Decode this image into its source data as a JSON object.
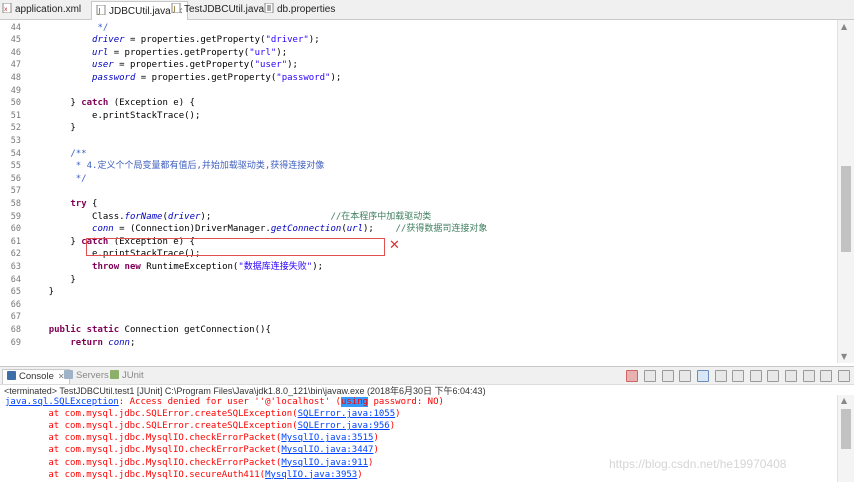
{
  "tabs": [
    {
      "label": "application.xml",
      "icon": "xml-file-icon",
      "active": false
    },
    {
      "label": "JDBCUtil.java",
      "icon": "java-file-icon",
      "active": true
    },
    {
      "label": "TestJDBCUtil.java",
      "icon": "java-file-icon",
      "active": false
    },
    {
      "label": "db.properties",
      "icon": "properties-file-icon",
      "active": false
    }
  ],
  "editor": {
    "lines": [
      {
        "n": "44",
        "tokens": [
          {
            "c": "cmt",
            "t": "             */"
          }
        ]
      },
      {
        "n": "45",
        "tokens": [
          {
            "c": "plain",
            "t": "            "
          },
          {
            "c": "fld",
            "t": "driver"
          },
          {
            "c": "plain",
            "t": " = properties.getProperty("
          },
          {
            "c": "str",
            "t": "\"driver\""
          },
          {
            "c": "plain",
            "t": ");"
          }
        ]
      },
      {
        "n": "46",
        "tokens": [
          {
            "c": "plain",
            "t": "            "
          },
          {
            "c": "fld",
            "t": "url"
          },
          {
            "c": "plain",
            "t": " = properties.getProperty("
          },
          {
            "c": "str",
            "t": "\"url\""
          },
          {
            "c": "plain",
            "t": ");"
          }
        ]
      },
      {
        "n": "47",
        "tokens": [
          {
            "c": "plain",
            "t": "            "
          },
          {
            "c": "fld",
            "t": "user"
          },
          {
            "c": "plain",
            "t": " = properties.getProperty("
          },
          {
            "c": "str",
            "t": "\"user\""
          },
          {
            "c": "plain",
            "t": ");"
          }
        ]
      },
      {
        "n": "48",
        "tokens": [
          {
            "c": "plain",
            "t": "            "
          },
          {
            "c": "fld",
            "t": "password"
          },
          {
            "c": "plain",
            "t": " = properties.getProperty("
          },
          {
            "c": "str",
            "t": "\"password\""
          },
          {
            "c": "plain",
            "t": ");"
          }
        ]
      },
      {
        "n": "49",
        "tokens": []
      },
      {
        "n": "50",
        "tokens": [
          {
            "c": "plain",
            "t": "        } "
          },
          {
            "c": "kw",
            "t": "catch"
          },
          {
            "c": "plain",
            "t": " (Exception e) {"
          }
        ]
      },
      {
        "n": "51",
        "tokens": [
          {
            "c": "plain",
            "t": "            e.printStackTrace();"
          }
        ]
      },
      {
        "n": "52",
        "tokens": [
          {
            "c": "plain",
            "t": "        }"
          }
        ]
      },
      {
        "n": "53",
        "tokens": []
      },
      {
        "n": "54",
        "tokens": [
          {
            "c": "cmt",
            "t": "        /**"
          }
        ]
      },
      {
        "n": "55",
        "tokens": [
          {
            "c": "cmt",
            "t": "         * 4.定义个个局变量都有值后,并始加载驱动类,获得连接对像"
          }
        ]
      },
      {
        "n": "56",
        "tokens": [
          {
            "c": "cmt",
            "t": "         */"
          }
        ]
      },
      {
        "n": "57",
        "tokens": []
      },
      {
        "n": "58",
        "tokens": [
          {
            "c": "plain",
            "t": "        "
          },
          {
            "c": "kw",
            "t": "try"
          },
          {
            "c": "plain",
            "t": " {"
          }
        ]
      },
      {
        "n": "59",
        "tokens": [
          {
            "c": "plain",
            "t": "            Class."
          },
          {
            "c": "fld",
            "t": "forName"
          },
          {
            "c": "plain",
            "t": "("
          },
          {
            "c": "fld",
            "t": "driver"
          },
          {
            "c": "plain",
            "t": ");                      "
          },
          {
            "c": "lcmt",
            "t": "//在本程序中加载驱动类"
          }
        ]
      },
      {
        "n": "60",
        "tokens": [
          {
            "c": "plain",
            "t": "            "
          },
          {
            "c": "fld",
            "t": "conn"
          },
          {
            "c": "plain",
            "t": " = (Connection)DriverManager."
          },
          {
            "c": "fld",
            "t": "getConnection"
          },
          {
            "c": "plain",
            "t": "("
          },
          {
            "c": "fld",
            "t": "url"
          },
          {
            "c": "plain",
            "t": ");    "
          },
          {
            "c": "lcmt",
            "t": "//获得数据司连接对象"
          }
        ]
      },
      {
        "n": "61",
        "tokens": [
          {
            "c": "plain",
            "t": "        } "
          },
          {
            "c": "kw",
            "t": "catch"
          },
          {
            "c": "plain",
            "t": " (Exception e) {"
          }
        ]
      },
      {
        "n": "62",
        "tokens": [
          {
            "c": "plain",
            "t": "            e.printStackTrace();"
          }
        ]
      },
      {
        "n": "63",
        "tokens": [
          {
            "c": "plain",
            "t": "            "
          },
          {
            "c": "kw",
            "t": "throw new"
          },
          {
            "c": "plain",
            "t": " RuntimeException("
          },
          {
            "c": "str",
            "t": "\"数据库连接失败\""
          },
          {
            "c": "plain",
            "t": ");"
          }
        ]
      },
      {
        "n": "64",
        "tokens": [
          {
            "c": "plain",
            "t": "        }"
          }
        ]
      },
      {
        "n": "65",
        "tokens": [
          {
            "c": "plain",
            "t": "    }"
          }
        ]
      },
      {
        "n": "66",
        "tokens": []
      },
      {
        "n": "67",
        "tokens": []
      },
      {
        "n": "68",
        "tokens": [
          {
            "c": "plain",
            "t": "    "
          },
          {
            "c": "kw",
            "t": "public static"
          },
          {
            "c": "plain",
            "t": " Connection getConnection(){"
          }
        ]
      },
      {
        "n": "69",
        "tokens": [
          {
            "c": "plain",
            "t": "        "
          },
          {
            "c": "kw",
            "t": "return"
          },
          {
            "c": "plain",
            "t": " "
          },
          {
            "c": "fld",
            "t": "conn"
          },
          {
            "c": "plain",
            "t": ";"
          }
        ]
      }
    ],
    "annotation_mark": "✕"
  },
  "console_tabs": [
    {
      "label": "Console",
      "icon": "console-icon",
      "active": true
    },
    {
      "label": "Servers",
      "icon": "servers-icon",
      "active": false
    },
    {
      "label": "JUnit",
      "icon": "junit-icon",
      "active": false
    }
  ],
  "terminated_text": "<terminated> TestJDBCUtil.test1 [JUnit] C:\\Program Files\\Java\\jdk1.8.0_121\\bin\\javaw.exe (2018年6月30日 下午6:04:43)",
  "console_lines": [
    [
      {
        "c": "link",
        "t": "java.sql.SQLException"
      },
      {
        "c": "err",
        "t": ": Access denied for user ''@'localhost' ("
      },
      {
        "c": "sel",
        "t": "using"
      },
      {
        "c": "err",
        "t": " password: NO)"
      }
    ],
    [
      {
        "c": "err",
        "t": "\tat com.mysql.jdbc.SQLError.createSQLException("
      },
      {
        "c": "link",
        "t": "SQLError.java:1055"
      },
      {
        "c": "err",
        "t": ")"
      }
    ],
    [
      {
        "c": "err",
        "t": "\tat com.mysql.jdbc.SQLError.createSQLException("
      },
      {
        "c": "link",
        "t": "SQLError.java:956"
      },
      {
        "c": "err",
        "t": ")"
      }
    ],
    [
      {
        "c": "err",
        "t": "\tat com.mysql.jdbc.MysqlIO.checkErrorPacket("
      },
      {
        "c": "link",
        "t": "MysqlIO.java:3515"
      },
      {
        "c": "err",
        "t": ")"
      }
    ],
    [
      {
        "c": "err",
        "t": "\tat com.mysql.jdbc.MysqlIO.checkErrorPacket("
      },
      {
        "c": "link",
        "t": "MysqlIO.java:3447"
      },
      {
        "c": "err",
        "t": ")"
      }
    ],
    [
      {
        "c": "err",
        "t": "\tat com.mysql.jdbc.MysqlIO.checkErrorPacket("
      },
      {
        "c": "link",
        "t": "MysqlIO.java:911"
      },
      {
        "c": "err",
        "t": ")"
      }
    ],
    [
      {
        "c": "err",
        "t": "\tat com.mysql.jdbc.MysqlIO.secureAuth411("
      },
      {
        "c": "link",
        "t": "MysqlIO.java:3953"
      },
      {
        "c": "err",
        "t": ")"
      }
    ]
  ],
  "watermark": "https://blog.csdn.net/he19970408",
  "colors": {
    "error": "#ff0000",
    "link": "#0044ff",
    "keyword": "#7f0055",
    "string": "#2a00ff",
    "field": "#0000c0",
    "comment": "#3f5fbf",
    "line_comment": "#3f7f5f"
  }
}
